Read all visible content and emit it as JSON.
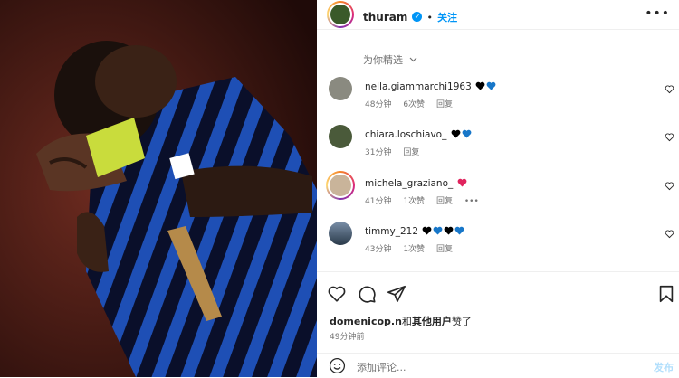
{
  "post": {
    "username": "thuram",
    "follow_label": "关注",
    "separator": "•",
    "more_label": "•••",
    "verified_mark": "✓"
  },
  "comments": {
    "sort_label": "为你精选",
    "items": [
      {
        "name": "nella.giammarchi1963",
        "hearts": [
          "#000000",
          "#1877c9"
        ],
        "time": "48分钟",
        "likes": "6次赞",
        "reply": "回复"
      },
      {
        "name": "chiara.loschiavo_",
        "hearts": [
          "#000000",
          "#1877c9"
        ],
        "time": "31分钟",
        "likes": "",
        "reply": "回复"
      },
      {
        "name": "michela_graziano_",
        "hearts": [
          "#e0245e"
        ],
        "time": "41分钟",
        "likes": "1次赞",
        "reply": "回复",
        "more": "•••"
      },
      {
        "name": "timmy_212",
        "hearts": [
          "#000000",
          "#1877c9",
          "#000000",
          "#1877c9"
        ],
        "time": "43分钟",
        "likes": "1次赞",
        "reply": "回复"
      }
    ]
  },
  "footer": {
    "liked_user": "domenicop.n",
    "liked_and": "和",
    "liked_others": "其他用户",
    "liked_suffix": "赞了",
    "time_ago": "49分钟前",
    "comment_placeholder": "添加评论...",
    "post_label": "发布"
  },
  "icons": {
    "like": "heart-outline-icon",
    "comment": "comment-icon",
    "share": "paper-plane-icon",
    "save": "bookmark-icon",
    "emoji": "smiley-icon"
  }
}
